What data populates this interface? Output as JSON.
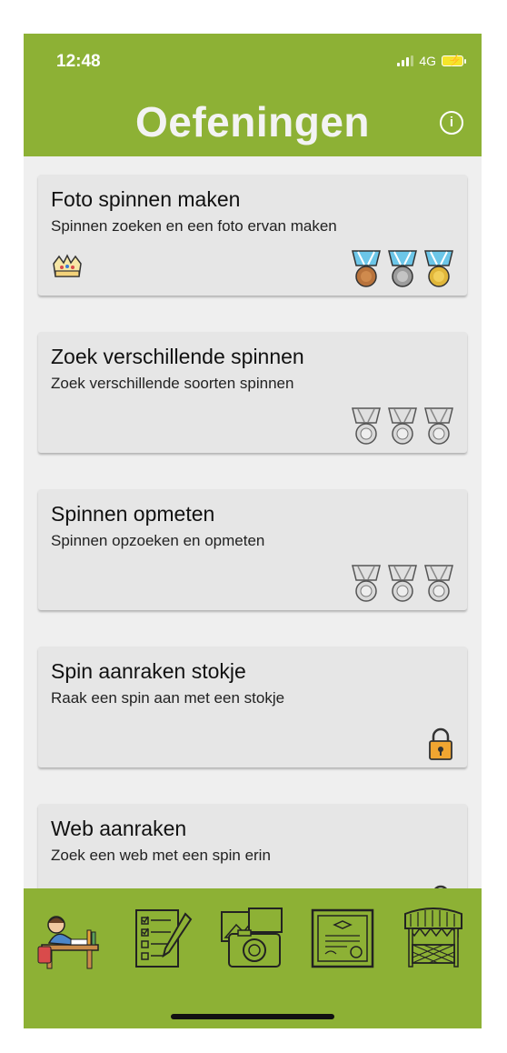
{
  "status_bar": {
    "time": "12:48",
    "network": "4G"
  },
  "header": {
    "title": "Oefeningen",
    "info_icon": "info-icon"
  },
  "exercises": [
    {
      "title": "Foto spinnen maken",
      "subtitle": "Spinnen zoeken en een foto ervan maken",
      "status": "medals-earned",
      "medals": [
        "bronze",
        "silver",
        "gold"
      ],
      "badge": "crown-icon"
    },
    {
      "title": "Zoek verschillende spinnen",
      "subtitle": "Zoek verschillende soorten spinnen",
      "status": "medals-empty",
      "medals": [
        "empty",
        "empty",
        "empty"
      ]
    },
    {
      "title": "Spinnen opmeten",
      "subtitle": "Spinnen opzoeken en opmeten",
      "status": "medals-empty",
      "medals": [
        "empty",
        "empty",
        "empty"
      ]
    },
    {
      "title": "Spin aanraken stokje",
      "subtitle": "Raak een spin aan met een stokje",
      "status": "locked"
    },
    {
      "title": "Web aanraken",
      "subtitle": "Zoek een web met een spin erin",
      "status": "locked"
    }
  ],
  "tabbar": {
    "tabs": [
      {
        "icon": "student-desk-icon"
      },
      {
        "icon": "checklist-icon"
      },
      {
        "icon": "photo-camera-icon"
      },
      {
        "icon": "certificate-icon"
      },
      {
        "icon": "market-stall-icon"
      }
    ]
  },
  "colors": {
    "brand_green": "#8db135",
    "card_bg": "#e6e6e6",
    "page_bg": "#efefef"
  }
}
